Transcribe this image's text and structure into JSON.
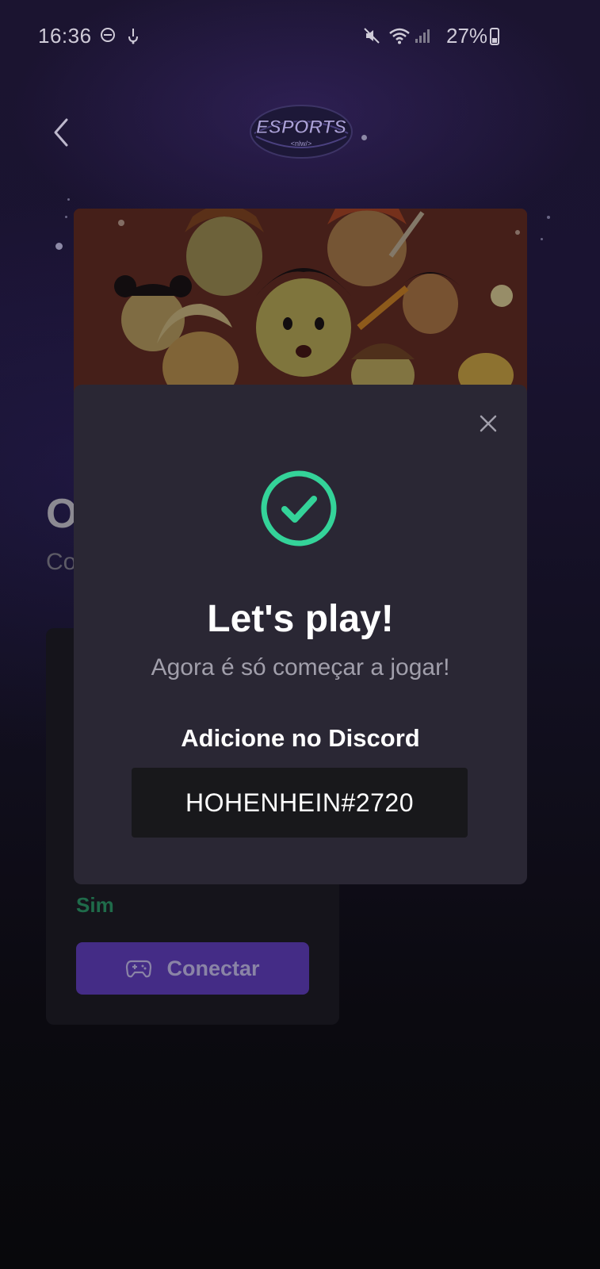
{
  "status_bar": {
    "time": "16:36",
    "battery": "27%",
    "icons": [
      "do-not-disturb-icon",
      "notification-icon",
      "mute-icon",
      "wifi-icon",
      "signal-icon",
      "battery-icon"
    ]
  },
  "header": {
    "back_icon": "chevron-left-icon",
    "logo_text": "ESPORTS",
    "logo_subtext": "<nlw/>"
  },
  "page": {
    "title_partial": "O",
    "subtitle_partial": "Co"
  },
  "ad_card": {
    "voice_value": "Sim",
    "connect_label": "Conectar",
    "connect_icon": "gamepad-icon"
  },
  "modal": {
    "close_icon": "close-icon",
    "status_icon": "check-circle-icon",
    "title": "Let's play!",
    "subtitle": "Agora é só começar a jogar!",
    "discord_label": "Adicione no Discord",
    "discord_tag": "HOHENHEIN#2720"
  },
  "colors": {
    "modal_bg": "#2a2734",
    "success": "#34d399",
    "accent": "#8b5cf6",
    "tag_bg": "#18181b"
  }
}
